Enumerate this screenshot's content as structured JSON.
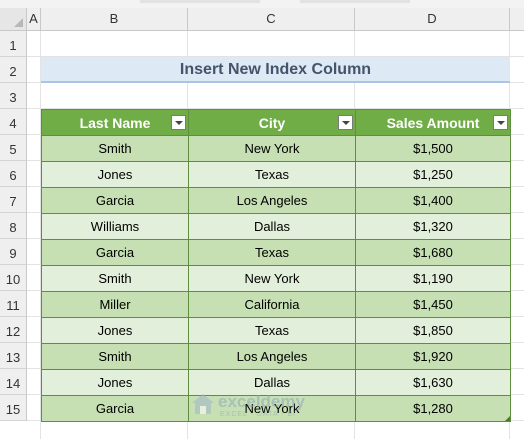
{
  "columns": [
    {
      "label": "A"
    },
    {
      "label": "B"
    },
    {
      "label": "C"
    },
    {
      "label": "D"
    }
  ],
  "rows": [
    "1",
    "2",
    "3",
    "4",
    "5",
    "6",
    "7",
    "8",
    "9",
    "10",
    "11",
    "12",
    "13",
    "14",
    "15"
  ],
  "title": "Insert New Index Column",
  "table": {
    "headers": [
      "Last Name",
      "City",
      "Sales Amount"
    ],
    "rows": [
      [
        "Smith",
        "New York",
        "$1,500"
      ],
      [
        "Jones",
        "Texas",
        "$1,250"
      ],
      [
        "Garcia",
        "Los Angeles",
        "$1,400"
      ],
      [
        "Williams",
        "Dallas",
        "$1,320"
      ],
      [
        "Garcia",
        "Texas",
        "$1,680"
      ],
      [
        "Smith",
        "New York",
        "$1,190"
      ],
      [
        "Miller",
        "California",
        "$1,450"
      ],
      [
        "Jones",
        "Texas",
        "$1,850"
      ],
      [
        "Smith",
        "Los Angeles",
        "$1,920"
      ],
      [
        "Jones",
        "Dallas",
        "$1,630"
      ],
      [
        "Garcia",
        "New York",
        "$1,280"
      ]
    ]
  },
  "watermark": {
    "name": "exceldemy",
    "tagline": "EXCEL · DATA · BI"
  },
  "colors": {
    "header_fill": "#70ad47",
    "band_dark": "#c6e0b4",
    "band_light": "#e2efda",
    "title_fill": "#dde9f5",
    "title_text": "#44546a"
  }
}
